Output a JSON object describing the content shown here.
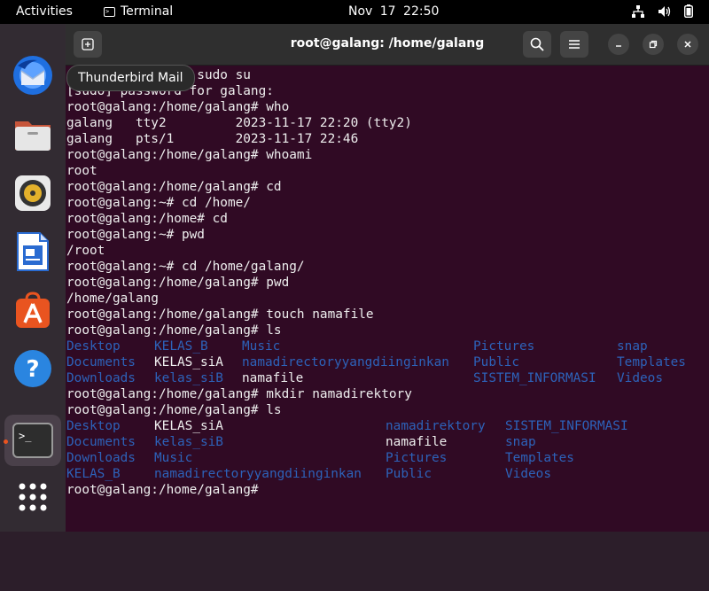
{
  "topbar": {
    "activities": "Activities",
    "app_name": "Terminal",
    "clock": "Nov 17  22:50"
  },
  "dock": {
    "items": [
      "Thunderbird Mail",
      "Files",
      "Rhythmbox",
      "LibreOffice Writer",
      "Ubuntu Software",
      "Help",
      "Terminal",
      "Show Applications"
    ],
    "tooltip": "Thunderbird Mail"
  },
  "window": {
    "title": "root@galang: /home/galang"
  },
  "terminal": {
    "lines": [
      "galang@galang:~$ sudo su",
      "[sudo] password for galang:",
      "root@galang:/home/galang# who",
      "galang   tty2         2023-11-17 22:20 (tty2)",
      "galang   pts/1        2023-11-17 22:46",
      "root@galang:/home/galang# whoami",
      "root",
      "root@galang:/home/galang# cd",
      "root@galang:~# cd /home/",
      "root@galang:/home# cd",
      "root@galang:~# pwd",
      "/root",
      "root@galang:~# cd /home/galang/",
      "root@galang:/home/galang# pwd",
      "/home/galang",
      "root@galang:/home/galang# touch namafile",
      "root@galang:/home/galang# ls"
    ],
    "ls1": [
      [
        {
          "t": "Desktop",
          "c": "blue"
        },
        {
          "t": "KELAS_B",
          "c": "blue"
        },
        {
          "t": "Music",
          "c": "blue"
        },
        {
          "t": "Pictures",
          "c": "blue"
        },
        {
          "t": "snap",
          "c": "blue"
        }
      ],
      [
        {
          "t": "Documents",
          "c": "blue"
        },
        {
          "t": "KELAS_siA",
          "c": "white"
        },
        {
          "t": "namadirectoryyangdiinginkan",
          "c": "blue"
        },
        {
          "t": "Public",
          "c": "blue"
        },
        {
          "t": "Templates",
          "c": "blue"
        }
      ],
      [
        {
          "t": "Downloads",
          "c": "blue"
        },
        {
          "t": "kelas_siB",
          "c": "blue"
        },
        {
          "t": "namafile",
          "c": "white"
        },
        {
          "t": "SISTEM_INFORMASI",
          "c": "blue"
        },
        {
          "t": "Videos",
          "c": "blue"
        }
      ]
    ],
    "lines2": [
      "root@galang:/home/galang# mkdir namadirektory",
      "root@galang:/home/galang# ls"
    ],
    "ls2": [
      [
        {
          "t": "Desktop",
          "c": "blue"
        },
        {
          "t": "KELAS_siA",
          "c": "white"
        },
        {
          "t": "",
          "c": "blue"
        },
        {
          "t": "namadirektory",
          "c": "blue"
        },
        {
          "t": "SISTEM_INFORMASI",
          "c": "blue"
        }
      ],
      [
        {
          "t": "Documents",
          "c": "blue"
        },
        {
          "t": "kelas_siB",
          "c": "blue"
        },
        {
          "t": "",
          "c": "blue"
        },
        {
          "t": "namafile",
          "c": "white"
        },
        {
          "t": "snap",
          "c": "blue"
        }
      ],
      [
        {
          "t": "Downloads",
          "c": "blue"
        },
        {
          "t": "Music",
          "c": "blue"
        },
        {
          "t": "",
          "c": "blue"
        },
        {
          "t": "Pictures",
          "c": "blue"
        },
        {
          "t": "Templates",
          "c": "blue"
        }
      ],
      [
        {
          "t": "KELAS_B",
          "c": "blue"
        },
        {
          "t": "namadirectoryyangdiinginkan",
          "c": "blue"
        },
        {
          "t": "",
          "c": "blue"
        },
        {
          "t": "Public",
          "c": "blue"
        },
        {
          "t": "Videos",
          "c": "blue"
        }
      ]
    ],
    "prompt": "root@galang:/home/galang#"
  },
  "colors": {
    "terminal_bg": "#300a24",
    "dir_blue": "#2d62b9",
    "accent": "#e95420"
  }
}
